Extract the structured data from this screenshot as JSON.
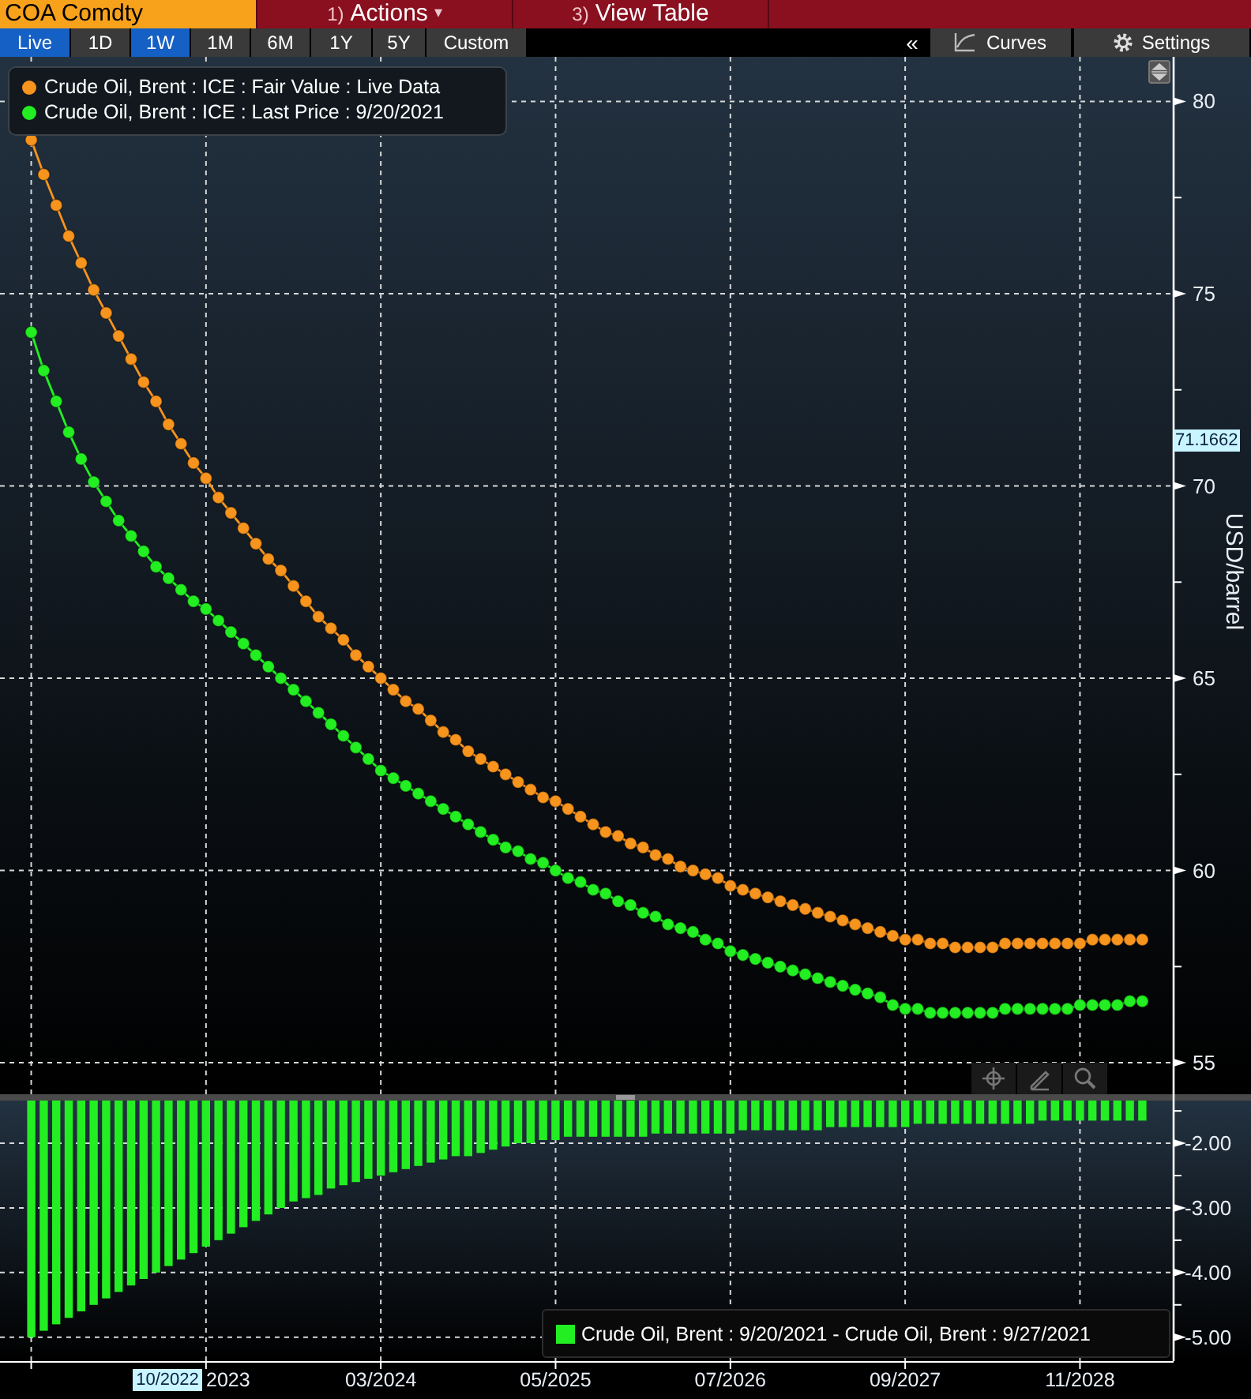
{
  "header": {
    "security": "COA Comdty",
    "menus": [
      {
        "number": "1)",
        "label": "Actions",
        "caret": "▾"
      },
      {
        "number": "3)",
        "label": "View Table"
      }
    ]
  },
  "ranges": [
    {
      "label": "Live",
      "selected": true
    },
    {
      "label": "1D",
      "selected": false
    },
    {
      "label": "1W",
      "selected": true
    },
    {
      "label": "1M",
      "selected": false
    },
    {
      "label": "6M",
      "selected": false
    },
    {
      "label": "1Y",
      "selected": false
    },
    {
      "label": "5Y",
      "selected": false
    },
    {
      "label": "Custom",
      "selected": false
    }
  ],
  "collapse": "«",
  "tools": [
    {
      "kind": "curves",
      "label": "Curves"
    },
    {
      "kind": "settings",
      "label": "Settings"
    }
  ],
  "price_chart": {
    "cursor_value": "71.1662",
    "chart_data": {
      "type": "line",
      "ylabel": "USD/barrel",
      "grid": true,
      "legend": true,
      "ylim": [
        54.18,
        81.16
      ],
      "yticks": [
        55,
        60,
        65,
        70,
        75,
        80
      ],
      "series": [
        {
          "name": "Crude Oil, Brent : ICE : Fair Value : Live Data",
          "color": "#f7941d",
          "values": [
            79.0,
            78.1,
            77.3,
            76.5,
            75.8,
            75.1,
            74.5,
            73.9,
            73.3,
            72.7,
            72.2,
            71.6,
            71.1,
            70.6,
            70.2,
            69.7,
            69.3,
            68.9,
            68.5,
            68.1,
            67.8,
            67.4,
            67.0,
            66.6,
            66.3,
            66.0,
            65.6,
            65.3,
            65.0,
            64.7,
            64.4,
            64.2,
            63.9,
            63.6,
            63.4,
            63.1,
            62.9,
            62.7,
            62.5,
            62.3,
            62.1,
            61.9,
            61.8,
            61.6,
            61.4,
            61.2,
            61.0,
            60.9,
            60.7,
            60.6,
            60.4,
            60.3,
            60.1,
            60.0,
            59.9,
            59.8,
            59.6,
            59.5,
            59.4,
            59.3,
            59.2,
            59.1,
            59.0,
            58.9,
            58.8,
            58.7,
            58.6,
            58.5,
            58.4,
            58.3,
            58.2,
            58.2,
            58.1,
            58.1,
            58.0,
            58.0,
            58.0,
            58.0,
            58.1,
            58.1,
            58.1,
            58.1,
            58.1,
            58.1,
            58.1,
            58.2,
            58.2,
            58.2,
            58.2,
            58.2
          ]
        },
        {
          "name": "Crude Oil, Brent : ICE : Last Price : 9/20/2021",
          "color": "#22ee22",
          "values": [
            74.0,
            73.0,
            72.2,
            71.4,
            70.7,
            70.1,
            69.6,
            69.1,
            68.7,
            68.3,
            67.9,
            67.6,
            67.3,
            67.0,
            66.8,
            66.5,
            66.2,
            65.9,
            65.6,
            65.3,
            65.0,
            64.7,
            64.4,
            64.1,
            63.8,
            63.5,
            63.2,
            62.9,
            62.6,
            62.4,
            62.2,
            62.0,
            61.8,
            61.6,
            61.4,
            61.2,
            61.0,
            60.8,
            60.6,
            60.5,
            60.3,
            60.2,
            60.0,
            59.8,
            59.7,
            59.5,
            59.4,
            59.2,
            59.1,
            58.9,
            58.8,
            58.6,
            58.5,
            58.4,
            58.2,
            58.1,
            57.9,
            57.8,
            57.7,
            57.6,
            57.5,
            57.4,
            57.3,
            57.2,
            57.1,
            57.0,
            56.9,
            56.8,
            56.7,
            56.5,
            56.4,
            56.4,
            56.3,
            56.3,
            56.3,
            56.3,
            56.3,
            56.3,
            56.4,
            56.4,
            56.4,
            56.4,
            56.4,
            56.4,
            56.5,
            56.5,
            56.5,
            56.5,
            56.6,
            56.6
          ]
        }
      ]
    }
  },
  "spread_chart": {
    "cursor_date": "10/2022",
    "axis_labels": [
      "2023",
      "03/2024",
      "05/2025",
      "07/2026",
      "09/2027",
      "11/2028"
    ],
    "chart_data": {
      "type": "bar",
      "grid": true,
      "legend": true,
      "ylim": [
        -5.37,
        -1.34
      ],
      "yticks": [
        {
          "value": -2,
          "label": "-2.00"
        },
        {
          "value": -3,
          "label": "-3.00"
        },
        {
          "value": -4,
          "label": "-4.00"
        },
        {
          "value": -5,
          "label": "-5.00"
        }
      ],
      "series": [
        {
          "name": "Crude Oil, Brent : 9/20/2021 - Crude Oil, Brent : 9/27/2021",
          "color": "#22ee22",
          "values": [
            -5.0,
            -4.9,
            -4.8,
            -4.7,
            -4.6,
            -4.5,
            -4.4,
            -4.3,
            -4.2,
            -4.1,
            -4.0,
            -3.9,
            -3.8,
            -3.7,
            -3.6,
            -3.5,
            -3.4,
            -3.3,
            -3.2,
            -3.1,
            -3.0,
            -2.9,
            -2.85,
            -2.8,
            -2.7,
            -2.65,
            -2.6,
            -2.55,
            -2.5,
            -2.45,
            -2.4,
            -2.35,
            -2.3,
            -2.25,
            -2.2,
            -2.2,
            -2.15,
            -2.1,
            -2.05,
            -2.0,
            -2.0,
            -1.95,
            -1.95,
            -1.9,
            -1.9,
            -1.9,
            -1.9,
            -1.9,
            -1.9,
            -1.9,
            -1.85,
            -1.85,
            -1.85,
            -1.85,
            -1.85,
            -1.85,
            -1.85,
            -1.8,
            -1.8,
            -1.8,
            -1.8,
            -1.8,
            -1.8,
            -1.8,
            -1.75,
            -1.75,
            -1.75,
            -1.75,
            -1.75,
            -1.75,
            -1.75,
            -1.7,
            -1.7,
            -1.7,
            -1.7,
            -1.7,
            -1.7,
            -1.7,
            -1.7,
            -1.7,
            -1.7,
            -1.65,
            -1.65,
            -1.65,
            -1.65,
            -1.65,
            -1.65,
            -1.65,
            -1.65,
            -1.65
          ]
        }
      ]
    }
  }
}
